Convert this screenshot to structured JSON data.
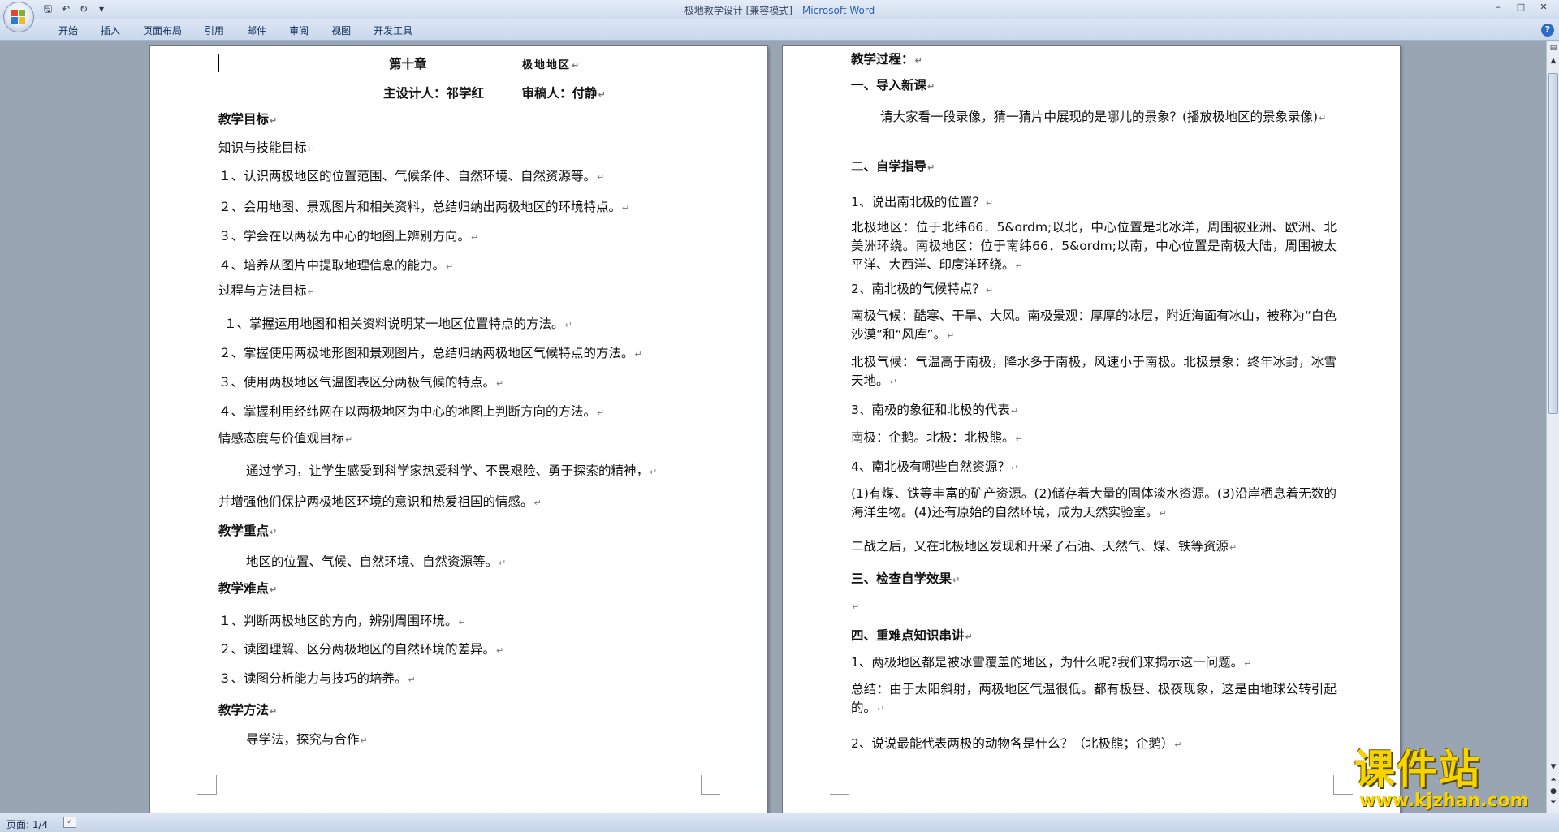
{
  "window": {
    "title_doc": "极地教学设计 [兼容模式]",
    "title_sep": " - ",
    "title_app": "Microsoft Word",
    "controls": [
      "–",
      "□",
      "✕"
    ]
  },
  "qat": [
    "save-icon",
    "undo-icon",
    "redo-icon",
    "customize-icon"
  ],
  "ribbon": {
    "tabs": [
      "开始",
      "插入",
      "页面布局",
      "引用",
      "邮件",
      "审阅",
      "视图",
      "开发工具"
    ],
    "help": "?"
  },
  "page1": {
    "chapter": "第十章",
    "chapter_title": "极地地区",
    "authors": "主设计人：祁学红　　　审稿人：付静",
    "lines": [
      {
        "text": "教学目标",
        "bold": true
      },
      {
        "text": "知识与技能目标",
        "bold": false
      },
      {
        "text": "１、认识两极地区的位置范围、气候条件、自然环境、自然资源等。",
        "bold": false
      },
      {
        "text": "２、会用地图、景观图片和相关资料，总结归纳出两极地区的环境特点。",
        "bold": false
      },
      {
        "text": "３、学会在以两极为中心的地图上辨别方向。",
        "bold": false
      },
      {
        "text": "４、培养从图片中提取地理信息的能力。",
        "bold": false
      },
      {
        "text": "过程与方法目标",
        "bold": false
      },
      {
        "text": "１、掌握运用地图和相关资料说明某一地区位置特点的方法。",
        "bold": false
      },
      {
        "text": "２、掌握使用两极地形图和景观图片，总结归纳两极地区气候特点的方法。",
        "bold": false
      },
      {
        "text": "３、使用两极地区气温图表区分两极气候的特点。",
        "bold": false
      },
      {
        "text": "４、掌握利用经纬网在以两极地区为中心的地图上判断方向的方法。",
        "bold": false
      },
      {
        "text": "情感态度与价值观目标",
        "bold": false
      },
      {
        "text": "通过学习，让学生感受到科学家热爱科学、不畏艰险、勇于探索的精神，",
        "bold": false
      },
      {
        "text": "并增强他们保护两极地区环境的意识和热爱祖国的情感。",
        "bold": false
      },
      {
        "text": "教学重点",
        "bold": true
      },
      {
        "text": "地区的位置、气候、自然环境、自然资源等。",
        "bold": false
      },
      {
        "text": "教学难点",
        "bold": true
      },
      {
        "text": "１、判断两极地区的方向，辨别周围环境。",
        "bold": false
      },
      {
        "text": "２、读图理解、区分两极地区的自然环境的差异。",
        "bold": false
      },
      {
        "text": "３、读图分析能力与技巧的培养。",
        "bold": false
      },
      {
        "text": "教学方法",
        "bold": true
      },
      {
        "text": "导学法，探究与合作",
        "bold": false
      }
    ]
  },
  "page2": {
    "blocks": [
      {
        "text": "教学过程：",
        "bold": true
      },
      {
        "text": "一、导入新课",
        "bold": true
      },
      {
        "text": "请大家看一段录像，猜一猜片中展现的是哪儿的景象？(播放极地区的景象录像)",
        "bold": false
      },
      {
        "text": "二、自学指导",
        "bold": true
      },
      {
        "text": "1、说出南北极的位置？",
        "bold": false
      },
      {
        "text": "北极地区：位于北纬66．5&ordm;以北，中心位置是北冰洋，周围被亚洲、欧洲、北美洲环绕。南极地区：位于南纬66．5&ordm;以南，中心位置是南极大陆，周围被太平洋、大西洋、印度洋环绕。",
        "bold": false
      },
      {
        "text": "2、南北极的气候特点？",
        "bold": false
      },
      {
        "text": "南极气候：酷寒、干旱、大风。南极景观：厚厚的冰层，附近海面有冰山，被称为“白色沙漠”和“风库”。",
        "bold": false
      },
      {
        "text": "北极气候：气温高于南极，降水多于南极，风速小于南极。北极景象：终年冰封，冰雪天地。",
        "bold": false
      },
      {
        "text": "3、南极的象征和北极的代表",
        "bold": false
      },
      {
        "text": "南极：企鹅。北极：北极熊。",
        "bold": false
      },
      {
        "text": "4、南北极有哪些自然资源？",
        "bold": false
      },
      {
        "text": "(1)有煤、铁等丰富的矿产资源。(2)储存着大量的固体淡水资源。(3)沿岸栖息着无数的海洋生物。(4)还有原始的自然环境，成为天然实验室。",
        "bold": false
      },
      {
        "text": "二战之后，又在北极地区发现和开采了石油、天然气、煤、铁等资源",
        "bold": false
      },
      {
        "text": "三、检查自学效果",
        "bold": true
      },
      {
        "text": "",
        "bold": false
      },
      {
        "text": "四、重难点知识串讲",
        "bold": true
      },
      {
        "text": "1、两极地区都是被冰雪覆盖的地区，为什么呢?我们来揭示这一问题。",
        "bold": false
      },
      {
        "text": "总结：由于太阳斜射，两极地区气温很低。都有极昼、极夜现象，这是由地球公转引起的。",
        "bold": false
      },
      {
        "text": "2、说说最能代表两极的动物各是什么？（北极熊；企鹅）",
        "bold": false
      }
    ]
  },
  "statusbar": {
    "page_count": "页面: 1/4"
  },
  "watermark": {
    "name": "课件站",
    "url": "www.kjzhan.com"
  }
}
